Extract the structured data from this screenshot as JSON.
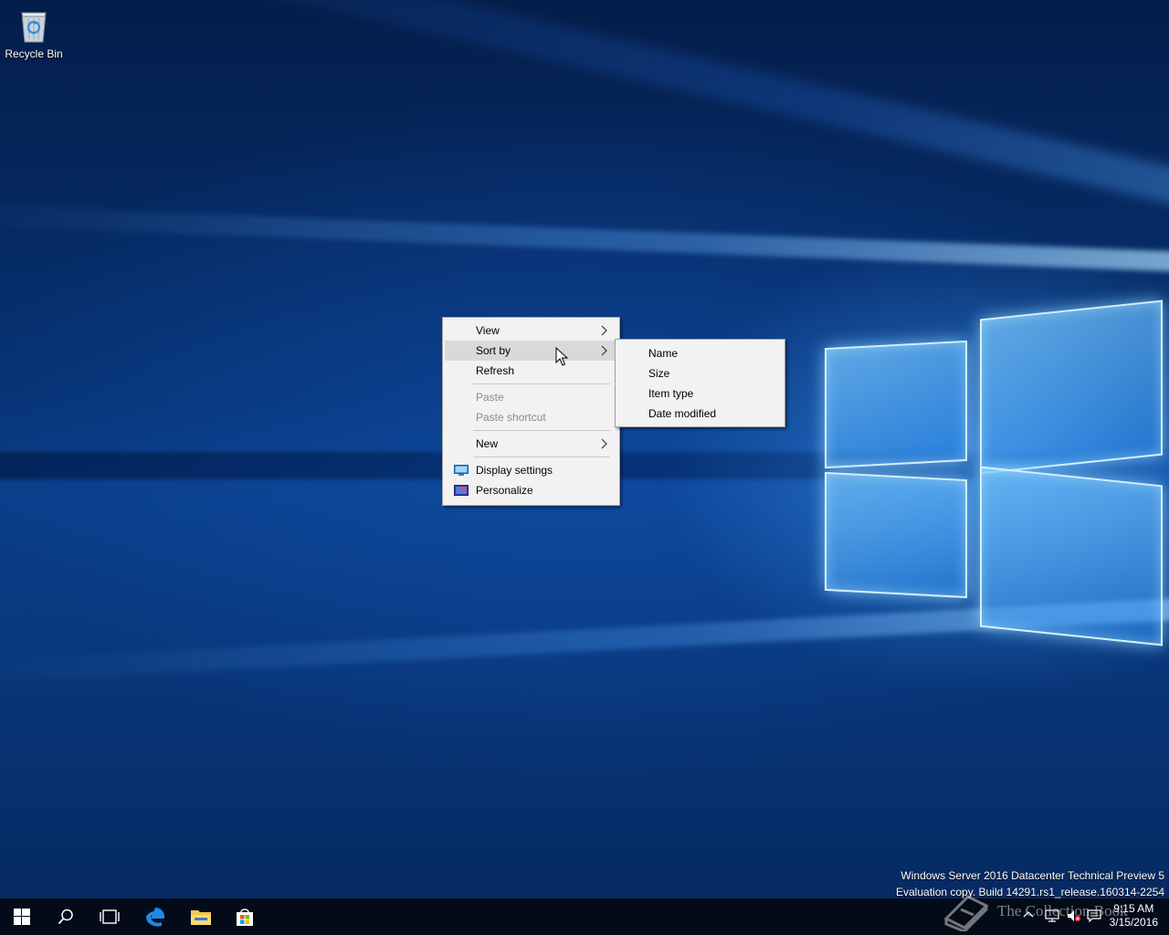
{
  "desktop": {
    "icons": [
      {
        "label": "Recycle Bin",
        "icon": "recycle-bin-icon"
      }
    ]
  },
  "context_menu": {
    "items": [
      {
        "label": "View",
        "submenu": true,
        "enabled": true
      },
      {
        "label": "Sort by",
        "submenu": true,
        "enabled": true,
        "highlighted": true
      },
      {
        "label": "Refresh",
        "submenu": false,
        "enabled": true
      },
      {
        "label": "Paste",
        "submenu": false,
        "enabled": false
      },
      {
        "label": "Paste shortcut",
        "submenu": false,
        "enabled": false
      },
      {
        "label": "New",
        "submenu": true,
        "enabled": true
      },
      {
        "label": "Display settings",
        "icon": "display-settings-icon",
        "enabled": true
      },
      {
        "label": "Personalize",
        "icon": "personalize-icon",
        "enabled": true
      }
    ]
  },
  "sort_by_submenu": {
    "items": [
      {
        "label": "Name"
      },
      {
        "label": "Size"
      },
      {
        "label": "Item type"
      },
      {
        "label": "Date modified"
      }
    ]
  },
  "watermark": {
    "line1": "Windows Server 2016 Datacenter Technical Preview 5",
    "line2": "Evaluation copy. Build 14291.rs1_release.160314-2254"
  },
  "taskbar": {
    "buttons": [
      "start-icon",
      "search-icon",
      "task-view-icon",
      "edge-icon",
      "file-explorer-icon",
      "store-icon"
    ],
    "clock_time": "9:15 AM",
    "clock_date": "3/15/2016"
  },
  "overlay_watermark": {
    "text": "The Collection Book"
  },
  "colors": {
    "taskbar": "#040b18",
    "menu_bg": "#f2f2f2",
    "menu_hover": "#d9d9d9",
    "desktop_accent": "#0a3f8a"
  }
}
